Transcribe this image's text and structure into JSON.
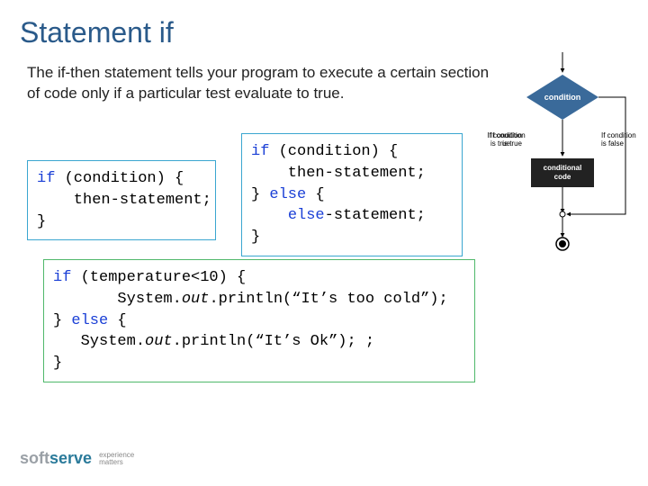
{
  "title": "Statement if",
  "body": "The if-then statement tells your program to execute a certain section of code only if a particular test evaluate to true.",
  "code1": {
    "l1a": "if",
    "l1b": " (condition) {",
    "l2": "    then-statement;",
    "l3": "}"
  },
  "code2": {
    "l1a": "if",
    "l1b": " (condition) {",
    "l2": "    then-statement;",
    "l3a": "} ",
    "l3b": "else",
    "l3c": " {",
    "l4a": "    ",
    "l4b": "else",
    "l4c": "-statement;",
    "l5": "}"
  },
  "code3": {
    "l1a": "if",
    "l1b": " (temperature<10) {",
    "l2a": "       System.",
    "l2b": "out",
    "l2c": ".println(“It’s too cold”);",
    "l3a": "} ",
    "l3b": "else",
    "l3c": " {",
    "l4a": "   System.",
    "l4b": "out",
    "l4c": ".println(“It’s Ok”); ;",
    "l5": "}"
  },
  "flow": {
    "condition": "condition",
    "code": "conditional\ncode",
    "true": "If condition\nis true",
    "false": "If condition\nis false"
  },
  "footer": {
    "soft": "soft",
    "serve": "serve",
    "tag1": "experience",
    "tag2": "matters"
  }
}
